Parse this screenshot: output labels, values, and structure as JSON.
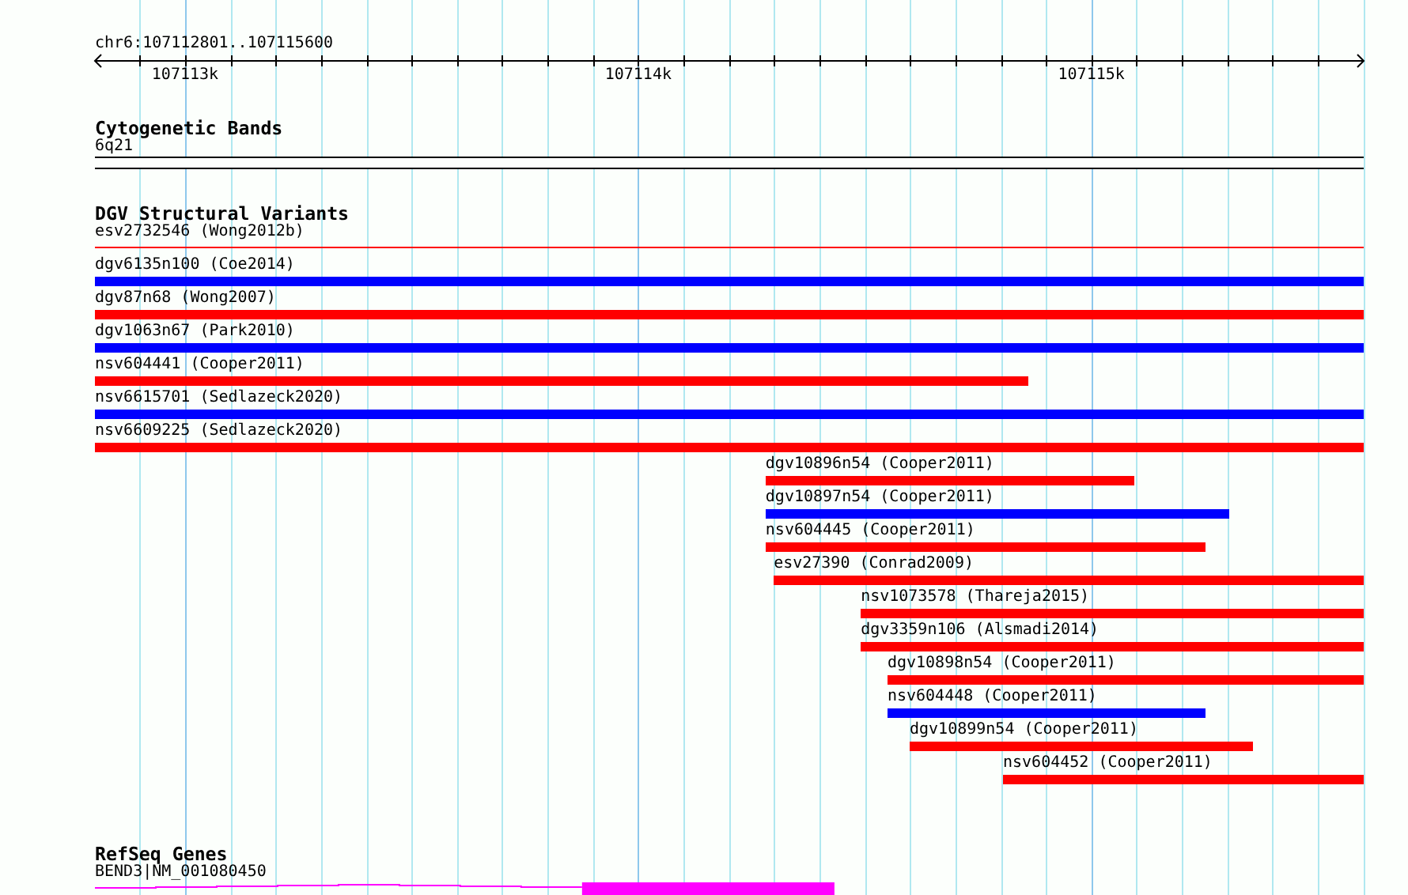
{
  "ruler": {
    "region": "chr6:107112801..107115600",
    "ticks": [
      {
        "label": "107113k"
      },
      {
        "label": "107114k"
      },
      {
        "label": "107115k"
      }
    ]
  },
  "tracks": [
    {
      "kind": "cytoband",
      "title": "Cytogenetic Bands",
      "features": [
        {
          "label": "6q21"
        }
      ]
    },
    {
      "kind": "variants",
      "title": "DGV Structural Variants",
      "features": [
        {
          "label": "esv2732546 (Wong2012b)",
          "color": "#ff0000",
          "kind": "line"
        },
        {
          "label": "dgv6135n100 (Coe2014)",
          "color": "#0000ff",
          "kind": "bar"
        },
        {
          "label": "dgv87n68 (Wong2007)",
          "color": "#ff0000",
          "kind": "bar"
        },
        {
          "label": "dgv1063n67 (Park2010)",
          "color": "#0000ff",
          "kind": "bar"
        },
        {
          "label": "nsv604441 (Cooper2011)",
          "color": "#ff0000",
          "kind": "bar"
        },
        {
          "label": "nsv6615701 (Sedlazeck2020)",
          "color": "#0000ff",
          "kind": "bar"
        },
        {
          "label": "nsv6609225 (Sedlazeck2020)",
          "color": "#ff0000",
          "kind": "bar"
        },
        {
          "label": "dgv10896n54 (Cooper2011)",
          "color": "#ff0000",
          "kind": "bar"
        },
        {
          "label": "dgv10897n54 (Cooper2011)",
          "color": "#0000ff",
          "kind": "bar"
        },
        {
          "label": "nsv604445 (Cooper2011)",
          "color": "#ff0000",
          "kind": "bar"
        },
        {
          "label": "esv27390 (Conrad2009)",
          "color": "#ff0000",
          "kind": "bar"
        },
        {
          "label": "nsv1073578 (Thareja2015)",
          "color": "#ff0000",
          "kind": "bar"
        },
        {
          "label": "dgv3359n106 (Alsmadi2014)",
          "color": "#ff0000",
          "kind": "bar"
        },
        {
          "label": "dgv10898n54 (Cooper2011)",
          "color": "#ff0000",
          "kind": "bar"
        },
        {
          "label": "nsv604448 (Cooper2011)",
          "color": "#0000ff",
          "kind": "bar"
        },
        {
          "label": "dgv10899n54 (Cooper2011)",
          "color": "#ff0000",
          "kind": "bar"
        },
        {
          "label": "nsv604452 (Cooper2011)",
          "color": "#ff0000",
          "kind": "bar"
        }
      ]
    },
    {
      "kind": "genes",
      "title": "RefSeq Genes",
      "features": [
        {
          "label": "BEND3|NM_001080450",
          "color": "#ff00ff"
        }
      ]
    }
  ]
}
